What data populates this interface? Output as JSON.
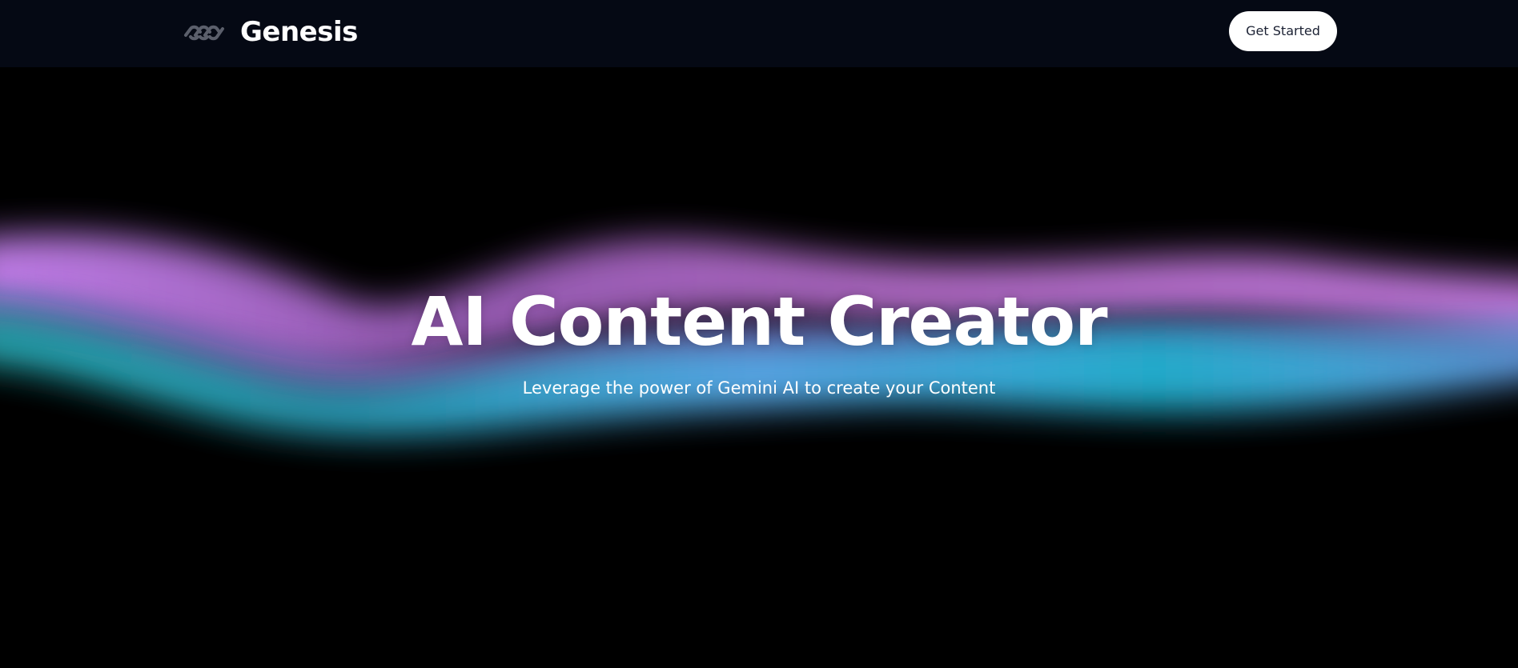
{
  "colors": {
    "background": "#000000",
    "navbar": "#050914",
    "button_bg": "#ffffff",
    "button_text": "#1b2133",
    "aurora_violet": "#c57ff0",
    "aurora_magenta": "#a65fb3",
    "aurora_teal": "#1fa8b0",
    "aurora_blue": "#56a9ea"
  },
  "navbar": {
    "logo_icon": "infinity-link-icon",
    "brand_name": "Genesis",
    "cta_label": "Get Started"
  },
  "hero": {
    "title": "AI Content Creator",
    "subtitle": "Leverage the power of Gemini AI to create your Content"
  }
}
